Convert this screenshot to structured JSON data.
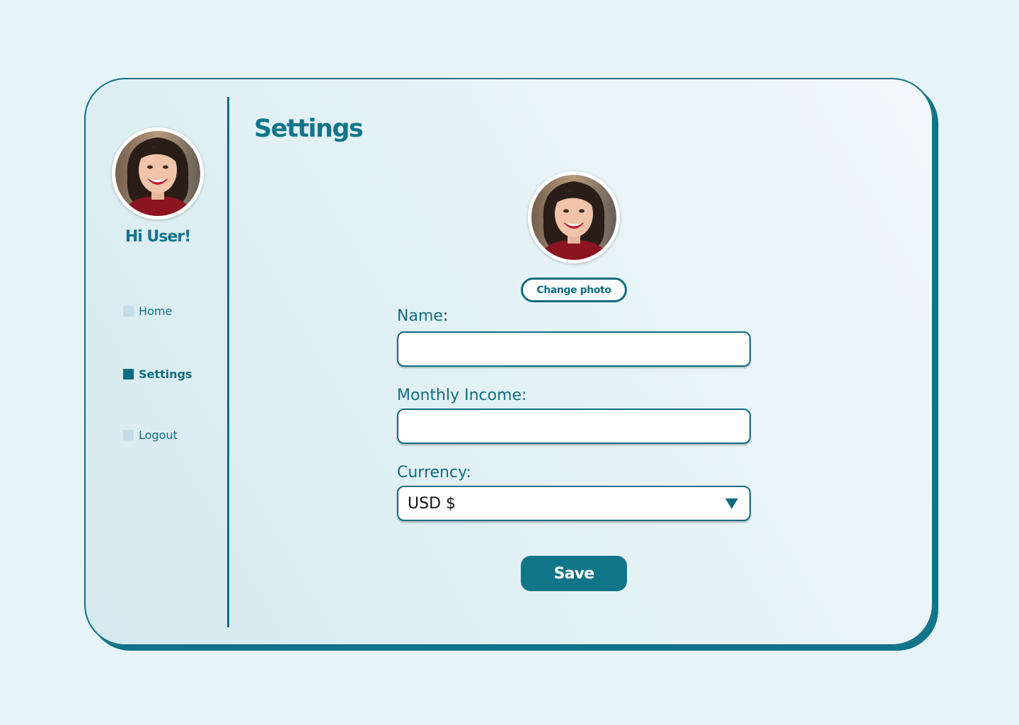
{
  "sidebar": {
    "greeting": "Hi User!",
    "avatar_icon": "user-photo",
    "items": [
      {
        "label": "Home",
        "active": false
      },
      {
        "label": "Settings",
        "active": true
      },
      {
        "label": "Logout",
        "active": false
      }
    ]
  },
  "main": {
    "title": "Settings",
    "avatar_icon": "user-photo",
    "change_photo_label": "Change photo",
    "form": {
      "name_label": "Name",
      "name_colon": ":",
      "name_value": "",
      "income_label": "Monthly Income:",
      "income_value": "",
      "currency_label": "Currency:",
      "currency_value": "USD $"
    },
    "save_label": "Save"
  },
  "colors": {
    "accent": "#0f6d82",
    "background": "#e6f4f9",
    "inactive_bullet": "#c4dde4"
  }
}
